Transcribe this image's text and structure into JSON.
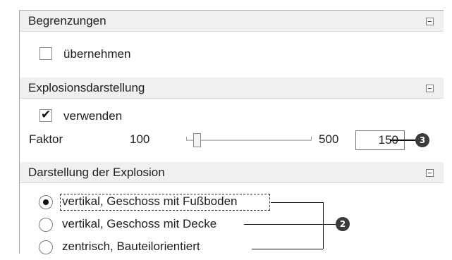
{
  "sections": {
    "begrenzungen": {
      "title": "Begrenzungen",
      "checkbox_label": "übernehmen",
      "checked": false
    },
    "explosion": {
      "title": "Explosionsdarstellung",
      "checkbox_label": "verwenden",
      "checked": true,
      "factor": {
        "label": "Faktor",
        "min": "100",
        "max": "500",
        "value": "150"
      }
    },
    "darstellung": {
      "title": "Darstellung der Explosion",
      "options": [
        {
          "label": "vertikal, Geschoss mit Fußboden",
          "selected": true
        },
        {
          "label": "vertikal, Geschoss mit Decke",
          "selected": false
        },
        {
          "label": "zentrisch, Bauteilorientiert",
          "selected": false
        }
      ]
    }
  },
  "callouts": {
    "factor_badge": "3",
    "options_badge": "2"
  },
  "check_glyph": "✔"
}
